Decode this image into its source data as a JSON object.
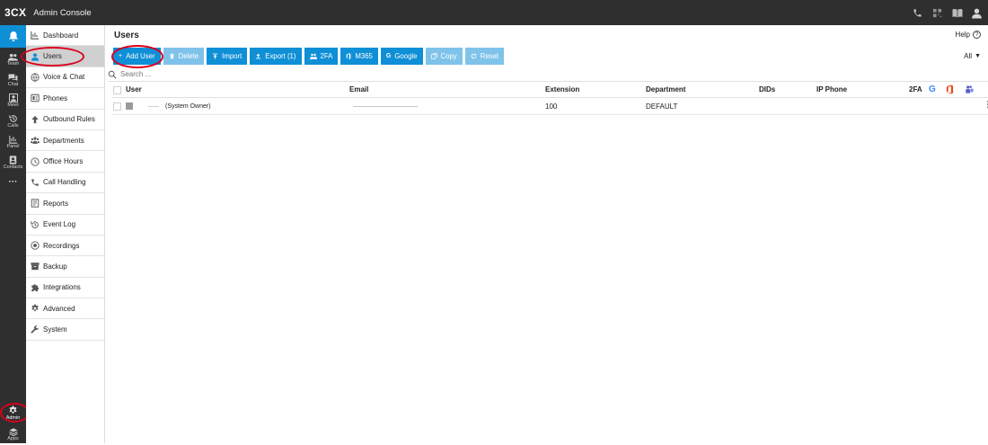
{
  "topbar": {
    "logo": "3CX",
    "title": "Admin Console"
  },
  "rail": {
    "items": [
      {
        "label": "",
        "icon": "bell-icon"
      },
      {
        "label": "Team",
        "icon": "team-icon"
      },
      {
        "label": "Chat",
        "icon": "chat-icon"
      },
      {
        "label": "Meet",
        "icon": "meet-icon"
      },
      {
        "label": "Calls",
        "icon": "history-icon"
      },
      {
        "label": "Panel",
        "icon": "panel-icon"
      },
      {
        "label": "Contacts",
        "icon": "contacts-icon"
      },
      {
        "label": "···",
        "icon": "more-icon"
      },
      {
        "label": "Admin",
        "icon": "gear-icon"
      },
      {
        "label": "Apps",
        "icon": "apps-icon"
      }
    ]
  },
  "sidebar": {
    "items": [
      {
        "label": "Dashboard"
      },
      {
        "label": "Users"
      },
      {
        "label": "Voice & Chat"
      },
      {
        "label": "Phones"
      },
      {
        "label": "Outbound Rules"
      },
      {
        "label": "Departments"
      },
      {
        "label": "Office Hours"
      },
      {
        "label": "Call Handling"
      },
      {
        "label": "Reports"
      },
      {
        "label": "Event Log"
      },
      {
        "label": "Recordings"
      },
      {
        "label": "Backup"
      },
      {
        "label": "Integrations"
      },
      {
        "label": "Advanced"
      },
      {
        "label": "System"
      }
    ]
  },
  "main": {
    "title": "Users",
    "help_label": "Help",
    "help_icon": "?",
    "filter_label": "All",
    "search_placeholder": "Search ...",
    "toolbar": {
      "add_user": "Add User",
      "delete": "Delete",
      "import": "Import",
      "export": "Export (1)",
      "twofa": "2FA",
      "m365": "M365",
      "google": "Google",
      "copy": "Copy",
      "reset": "Reset"
    },
    "columns": {
      "user": "User",
      "email": "Email",
      "extension": "Extension",
      "department": "Department",
      "dids": "DIDs",
      "ip_phone": "IP Phone",
      "twofa": "2FA"
    },
    "rows": [
      {
        "user": "(System Owner)",
        "email": "",
        "extension": "100",
        "department": "DEFAULT"
      }
    ]
  },
  "colors": {
    "accent": "#0f8fd6",
    "accent_disabled": "#7fc3ea",
    "dark_bar": "#2f2f2f",
    "highlight_ring": "#d9001b"
  }
}
